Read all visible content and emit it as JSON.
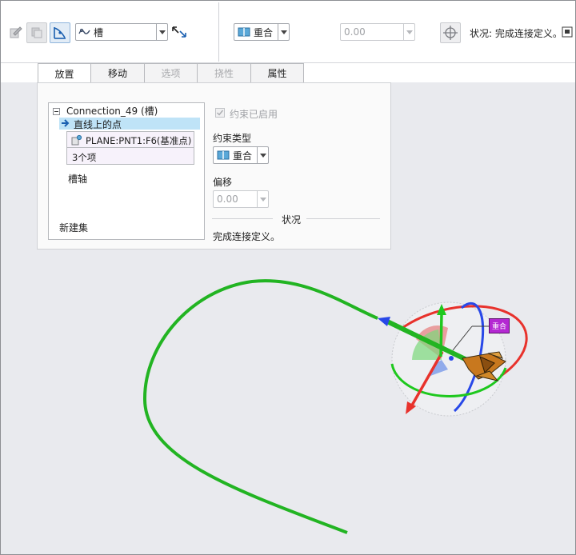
{
  "toolbar": {
    "connection_type_selected": "槽",
    "constraint_type_selected": "重合",
    "offset_value": "0.00",
    "status_text": "状况: 完成连接定义。"
  },
  "tabs": [
    {
      "label": "放置",
      "state": "active"
    },
    {
      "label": "移动",
      "state": "normal"
    },
    {
      "label": "选项",
      "state": "disabled"
    },
    {
      "label": "挠性",
      "state": "disabled"
    },
    {
      "label": "属性",
      "state": "normal"
    }
  ],
  "placement": {
    "tree": {
      "connection_label": "Connection_49 (槽)",
      "point_on_line_label": "直线上的点",
      "reference_item": "PLANE:PNT1:F6(基准点)",
      "item_count": "3个项",
      "slot_axis_label": "槽轴",
      "new_set_label": "新建集"
    },
    "constraint_enabled_label": "约束已启用",
    "constraint_enabled_checked": true,
    "constraint_type_label": "约束类型",
    "constraint_type_value": "重合",
    "offset_label": "偏移",
    "offset_value": "0.00",
    "status_section_label": "状况",
    "status_message": "完成连接定义。"
  },
  "viewport": {
    "dragger_tag_label": "重合",
    "colors": {
      "path": "#22b422",
      "axis_x": "#e8322c",
      "axis_y": "#1ec81e",
      "axis_z": "#2848e8",
      "tag_bg": "#b428d2",
      "selection_highlight": "#bfe3f7"
    }
  },
  "icons": [
    "edit-definition-icon",
    "copy-icon",
    "user-defined-icon",
    "slot-connection-icon",
    "flip-icon",
    "coincident-icon",
    "dragger-icon",
    "window-icon",
    "collapse-icon",
    "arrow-right-icon",
    "datum-point-icon",
    "checkbox-icon"
  ]
}
